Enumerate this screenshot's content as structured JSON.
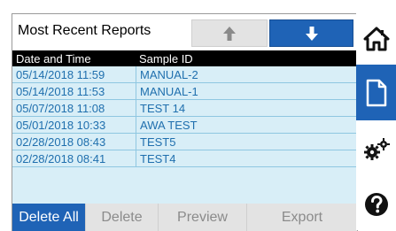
{
  "header": {
    "title": "Most Recent Reports",
    "up_icon": "arrow-up-icon",
    "down_icon": "arrow-down-icon"
  },
  "table": {
    "columns": [
      "Date and Time",
      "Sample ID"
    ],
    "rows": [
      {
        "date": "05/14/2018 11:59",
        "sample": "MANUAL-2"
      },
      {
        "date": "05/14/2018 11:53",
        "sample": "MANUAL-1"
      },
      {
        "date": "05/07/2018 11:08",
        "sample": "TEST 14"
      },
      {
        "date": "05/01/2018 10:33",
        "sample": "AWA TEST"
      },
      {
        "date": "02/28/2018 08:43",
        "sample": "TEST5"
      },
      {
        "date": "02/28/2018 08:41",
        "sample": "TEST4"
      }
    ]
  },
  "footer": {
    "delete_all": "Delete All",
    "delete": "Delete",
    "preview": "Preview",
    "export": "Export"
  },
  "sidebar": {
    "items": [
      {
        "icon": "home-icon",
        "active": false
      },
      {
        "icon": "document-icon",
        "active": true
      },
      {
        "icon": "gears-icon",
        "active": false
      },
      {
        "icon": "help-icon",
        "active": false
      }
    ]
  },
  "colors": {
    "accent": "#1f63b6",
    "row_bg": "#d8eef7",
    "row_text": "#1f6fae",
    "disabled_bg": "#e3e3e3",
    "disabled_text": "#8b8b8b"
  }
}
